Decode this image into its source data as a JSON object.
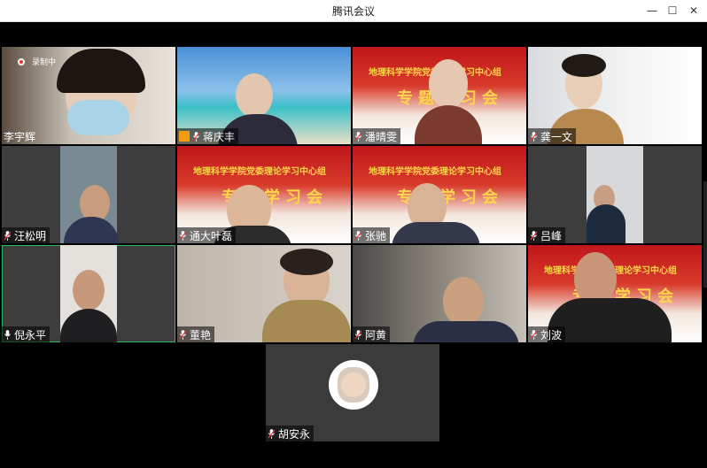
{
  "window": {
    "title": "腾讯会议"
  },
  "recording_label": "录制中",
  "participants": [
    {
      "name": "李宇辉"
    },
    {
      "name": "蒋庆丰"
    },
    {
      "name": "潘晴雯"
    },
    {
      "name": "龚一文"
    },
    {
      "name": "汪松明"
    },
    {
      "name": "通大叶磊"
    },
    {
      "name": "张驰"
    },
    {
      "name": "吕峰"
    },
    {
      "name": "倪永平"
    },
    {
      "name": "董艳"
    },
    {
      "name": "阿黄"
    },
    {
      "name": "刘波"
    },
    {
      "name": "胡安永"
    }
  ],
  "banner": {
    "line1": "地理科学学院党委理论学习中心组",
    "line2": "专题学习会"
  },
  "colors": {
    "active_speaker": "#2ebd59",
    "banner_red": "#c0161a",
    "banner_gold": "#ffd54a"
  }
}
